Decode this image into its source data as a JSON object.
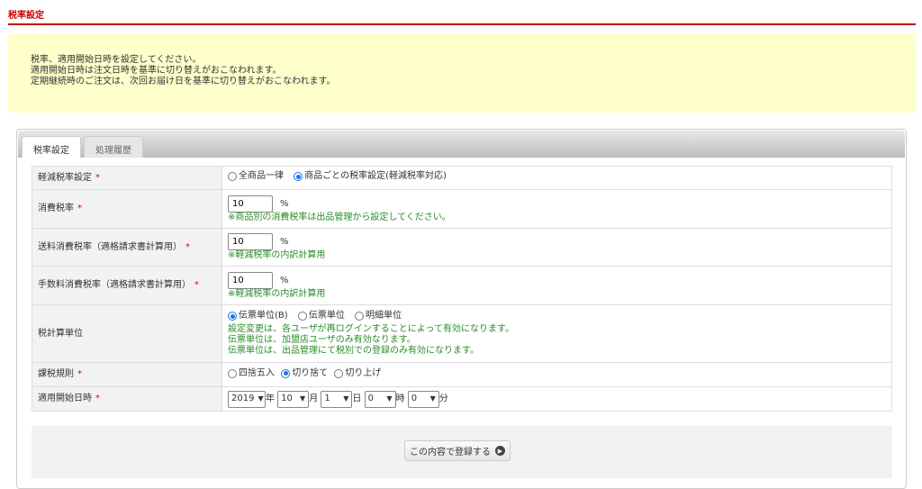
{
  "page_title": "税率設定",
  "notice": [
    "税率、適用開始日時を設定してください。",
    "適用開始日時は注文日時を基準に切り替えがおこなわれます。",
    "定期継続時のご注文は、次回お届け日を基準に切り替えがおこなわれます。"
  ],
  "tabs": [
    "税率設定",
    "処理履歴"
  ],
  "required_mark": "*",
  "rows": {
    "reduced": {
      "label": "軽減税率設定",
      "options": [
        "全商品一律",
        "商品ごとの税率設定(軽減税率対応)"
      ],
      "selected": 1
    },
    "tax_rate": {
      "label": "消費税率",
      "value": "10",
      "unit": "%",
      "note": "※商品別の消費税率は出品管理から設定してください。"
    },
    "shipping_rate": {
      "label": "送料消費税率（適格請求書計算用）",
      "value": "10",
      "unit": "%",
      "note": "※軽減税率の内訳計算用"
    },
    "fee_rate": {
      "label": "手数料消費税率（適格請求書計算用）",
      "value": "10",
      "unit": "%",
      "note": "※軽減税率の内訳計算用"
    },
    "calc_unit": {
      "label": "税計算単位",
      "options": [
        "伝票単位(B)",
        "伝票単位",
        "明細単位"
      ],
      "selected": 0,
      "notes": [
        "設定変更は、各ユーザが再ログインすることによって有効になります。",
        "伝票単位は、加盟店ユーザのみ有効なります。",
        "伝票単位は、出品管理にて税別での登録のみ有効になります。"
      ]
    },
    "rounding": {
      "label": "課税規則",
      "options": [
        "四捨五入",
        "切り捨て",
        "切り上げ"
      ],
      "selected": 1
    },
    "start": {
      "label": "適用開始日時",
      "year": "2019",
      "year_unit": "年",
      "month": "10",
      "month_unit": "月",
      "day": "1",
      "day_unit": "日",
      "hour": "0",
      "hour_unit": "時",
      "minute": "0",
      "minute_unit": "分"
    }
  },
  "submit_label": "この内容で登録する"
}
